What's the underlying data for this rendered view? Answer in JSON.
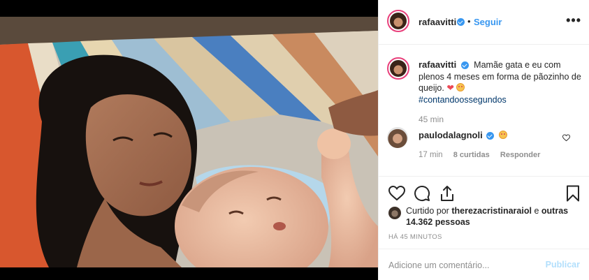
{
  "post": {
    "author": "rafaavitti",
    "follow_label": "Seguir",
    "separator": "•",
    "more_label": "•••",
    "caption": {
      "author": "rafaavitti",
      "text": "Mamãe gata e eu com plenos 4 meses em forma de pãozinho de queijo.",
      "hashtag": "#contandoossegundos",
      "time": "45 min"
    },
    "reply": {
      "author": "paulodalagnoli",
      "time": "17 min",
      "likes": "8 curtidas",
      "reply_label": "Responder"
    },
    "likes": {
      "prefix": "Curtido por",
      "user": "therezacristinaraiol",
      "connector": "e",
      "others": "outras 14.362 pessoas"
    },
    "posted_ago": "HÁ 45 MINUTOS",
    "add_comment": {
      "placeholder": "Adicione um comentário...",
      "post_label": "Publicar"
    }
  },
  "icons": {
    "verified": "verified-badge-icon",
    "like": "heart-icon",
    "comment": "comment-icon",
    "share": "share-icon",
    "save": "bookmark-icon",
    "emoji": "smiling-face-with-hearts-emoji"
  },
  "colors": {
    "accent_blue": "#3897f0",
    "heart_red": "#ed4956",
    "muted_text": "#8e8e8e",
    "hashtag": "#00376b",
    "post_button_disabled": "#b2dffc",
    "avatar_ring": "#e8407b"
  }
}
